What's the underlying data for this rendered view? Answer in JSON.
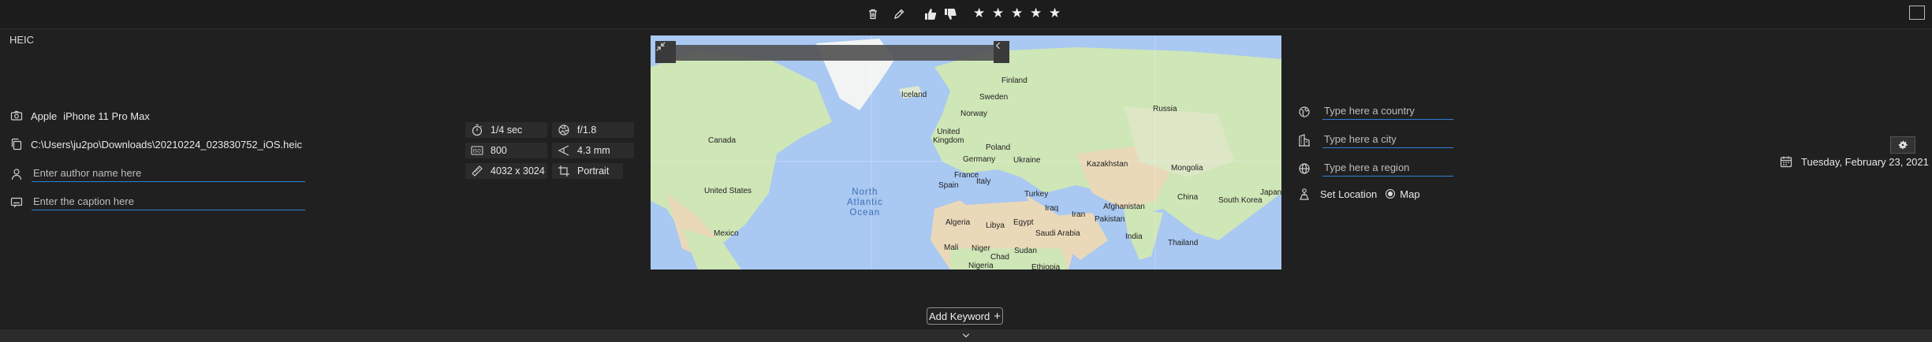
{
  "toolbar": {
    "icons": [
      "trash-icon",
      "pencil-icon",
      "thumbs-up-icon",
      "thumbs-down-icon"
    ],
    "rating": {
      "stars": 5,
      "value": 0
    }
  },
  "file": {
    "format": "HEIC",
    "camera_make": "Apple",
    "camera_model": "iPhone 11 Pro Max",
    "path": "C:\\Users\\ju2po\\Downloads\\20210224_023830752_iOS.heic",
    "author_placeholder": "Enter author name here",
    "caption_placeholder": "Enter the caption here"
  },
  "exif": {
    "shutter": "1/4 sec",
    "aperture": "f/1.8",
    "iso": "800",
    "focal_length": "4.3 mm",
    "dimensions": "4032 x 3024",
    "orientation": "Portrait"
  },
  "map": {
    "labels": {
      "finland": "Finland",
      "iceland": "Iceland",
      "sweden": "Sweden",
      "norway": "Norway",
      "russia": "Russia",
      "canada": "Canada",
      "united_kingdom": "United\nKingdom",
      "poland": "Poland",
      "germany": "Germany",
      "ukraine": "Ukraine",
      "kazakhstan": "Kazakhstan",
      "mongolia": "Mongolia",
      "france": "France",
      "spain": "Spain",
      "italy": "Italy",
      "turkey": "Turkey",
      "china": "China",
      "south_korea": "South Korea",
      "japan": "Japan",
      "united_states": "United States",
      "iraq": "Iraq",
      "iran": "Iran",
      "afghanistan": "Afghanistan",
      "pakistan": "Pakistan",
      "algeria": "Algeria",
      "libya": "Libya",
      "egypt": "Egypt",
      "saudi_arabia": "Saudi Arabia",
      "india": "India",
      "mexico": "Mexico",
      "mali": "Mali",
      "niger": "Niger",
      "chad": "Chad",
      "sudan": "Sudan",
      "thailand": "Thailand",
      "nigeria": "Nigeria",
      "ethiopia": "Ethiopia"
    },
    "ocean": "North\nAtlantic\nOcean"
  },
  "location": {
    "country_placeholder": "Type here a country",
    "city_placeholder": "Type here a city",
    "region_placeholder": "Type here a region",
    "set_location_label": "Set Location",
    "map_option_label": "Map"
  },
  "date": {
    "value": "Tuesday, February 23, 2021"
  },
  "keywords": {
    "add_label": "Add Keyword"
  },
  "colors": {
    "accent": "#2f7fd6",
    "background": "#202020",
    "map_water": "#a9c8f2",
    "map_land": "#cfe6b7"
  }
}
